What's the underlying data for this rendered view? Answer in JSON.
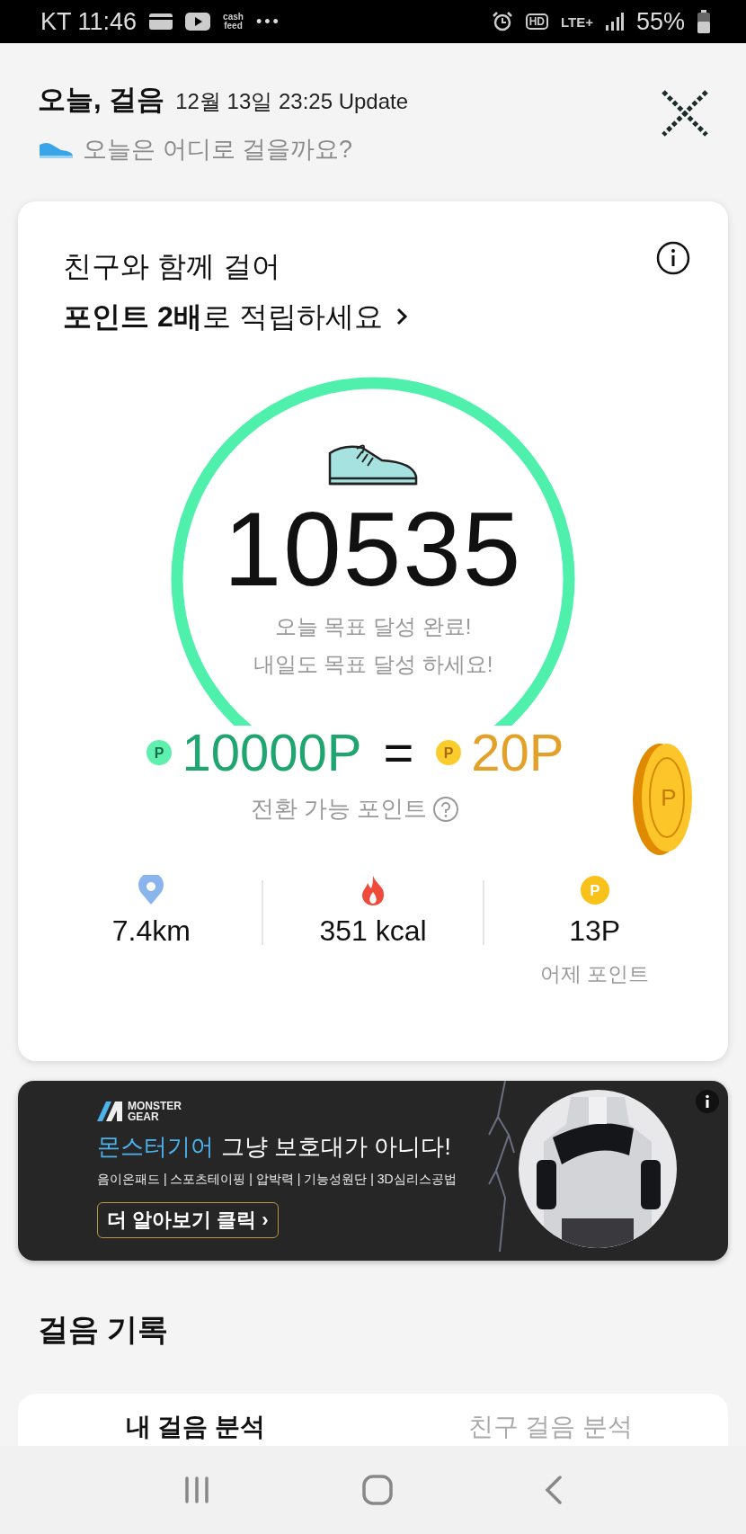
{
  "status_bar": {
    "carrier_time": "KT 11:46",
    "app_label_top": "cash",
    "app_label_bottom": "feed",
    "more": "•••",
    "hd": "HD",
    "network": "LTE+",
    "battery": "55%"
  },
  "header": {
    "title": "오늘, 걸음",
    "updated": "12월 13일 23:25 Update",
    "subtitle": "오늘은 어디로 걸을까요?"
  },
  "step_card": {
    "promo_line_1": "친구와 함께 걸어",
    "promo_line_2": "**포인트 2배**로 적립하세요",
    "steps": "10535",
    "message_line_1": "오늘 목표 달성 완료!",
    "message_line_2": "내일도 목표 달성 하세요!",
    "points_from_coin": "P",
    "points_from": "10000P",
    "equals": "=",
    "points_to_coin": "P",
    "points_to": "20P",
    "big_coin": "P",
    "conversion_label": "전환 가능 포인트",
    "stats": [
      {
        "kind": "distance",
        "value": "7.4km"
      },
      {
        "kind": "calories",
        "value": "351 kcal"
      },
      {
        "kind": "points",
        "coin": "P",
        "value": "13P",
        "caption": "어제 포인트"
      }
    ]
  },
  "ad_banner": {
    "brand_top": "MONSTER",
    "brand_bottom": "GEAR",
    "headline_brand": "몬스터기어",
    "headline_rest": "그냥 보호대가 아니다!",
    "features": "음이온패드 | 스포츠테이핑 | 압박력 | 기능성원단 | 3D심리스공법",
    "cta": "더 알아보기 클릭 ›"
  },
  "records": {
    "title": "걸음 기록",
    "tabs": [
      {
        "label": "내 걸음 분석",
        "selected": true
      },
      {
        "label": "친구 걸음 분석",
        "selected": false
      }
    ]
  }
}
